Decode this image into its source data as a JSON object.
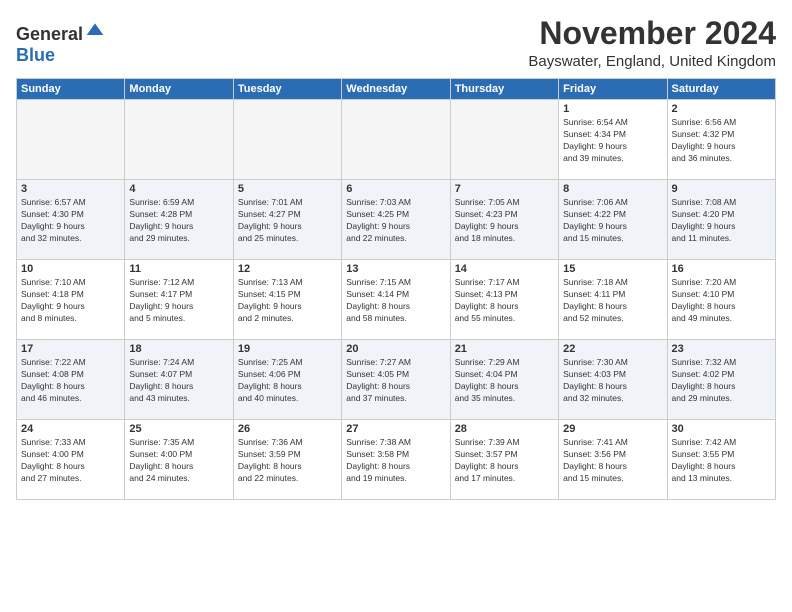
{
  "logo": {
    "general": "General",
    "blue": "Blue"
  },
  "header": {
    "month": "November 2024",
    "location": "Bayswater, England, United Kingdom"
  },
  "weekdays": [
    "Sunday",
    "Monday",
    "Tuesday",
    "Wednesday",
    "Thursday",
    "Friday",
    "Saturday"
  ],
  "weeks": [
    [
      {
        "day": "",
        "info": ""
      },
      {
        "day": "",
        "info": ""
      },
      {
        "day": "",
        "info": ""
      },
      {
        "day": "",
        "info": ""
      },
      {
        "day": "",
        "info": ""
      },
      {
        "day": "1",
        "info": "Sunrise: 6:54 AM\nSunset: 4:34 PM\nDaylight: 9 hours\nand 39 minutes."
      },
      {
        "day": "2",
        "info": "Sunrise: 6:56 AM\nSunset: 4:32 PM\nDaylight: 9 hours\nand 36 minutes."
      }
    ],
    [
      {
        "day": "3",
        "info": "Sunrise: 6:57 AM\nSunset: 4:30 PM\nDaylight: 9 hours\nand 32 minutes."
      },
      {
        "day": "4",
        "info": "Sunrise: 6:59 AM\nSunset: 4:28 PM\nDaylight: 9 hours\nand 29 minutes."
      },
      {
        "day": "5",
        "info": "Sunrise: 7:01 AM\nSunset: 4:27 PM\nDaylight: 9 hours\nand 25 minutes."
      },
      {
        "day": "6",
        "info": "Sunrise: 7:03 AM\nSunset: 4:25 PM\nDaylight: 9 hours\nand 22 minutes."
      },
      {
        "day": "7",
        "info": "Sunrise: 7:05 AM\nSunset: 4:23 PM\nDaylight: 9 hours\nand 18 minutes."
      },
      {
        "day": "8",
        "info": "Sunrise: 7:06 AM\nSunset: 4:22 PM\nDaylight: 9 hours\nand 15 minutes."
      },
      {
        "day": "9",
        "info": "Sunrise: 7:08 AM\nSunset: 4:20 PM\nDaylight: 9 hours\nand 11 minutes."
      }
    ],
    [
      {
        "day": "10",
        "info": "Sunrise: 7:10 AM\nSunset: 4:18 PM\nDaylight: 9 hours\nand 8 minutes."
      },
      {
        "day": "11",
        "info": "Sunrise: 7:12 AM\nSunset: 4:17 PM\nDaylight: 9 hours\nand 5 minutes."
      },
      {
        "day": "12",
        "info": "Sunrise: 7:13 AM\nSunset: 4:15 PM\nDaylight: 9 hours\nand 2 minutes."
      },
      {
        "day": "13",
        "info": "Sunrise: 7:15 AM\nSunset: 4:14 PM\nDaylight: 8 hours\nand 58 minutes."
      },
      {
        "day": "14",
        "info": "Sunrise: 7:17 AM\nSunset: 4:13 PM\nDaylight: 8 hours\nand 55 minutes."
      },
      {
        "day": "15",
        "info": "Sunrise: 7:18 AM\nSunset: 4:11 PM\nDaylight: 8 hours\nand 52 minutes."
      },
      {
        "day": "16",
        "info": "Sunrise: 7:20 AM\nSunset: 4:10 PM\nDaylight: 8 hours\nand 49 minutes."
      }
    ],
    [
      {
        "day": "17",
        "info": "Sunrise: 7:22 AM\nSunset: 4:08 PM\nDaylight: 8 hours\nand 46 minutes."
      },
      {
        "day": "18",
        "info": "Sunrise: 7:24 AM\nSunset: 4:07 PM\nDaylight: 8 hours\nand 43 minutes."
      },
      {
        "day": "19",
        "info": "Sunrise: 7:25 AM\nSunset: 4:06 PM\nDaylight: 8 hours\nand 40 minutes."
      },
      {
        "day": "20",
        "info": "Sunrise: 7:27 AM\nSunset: 4:05 PM\nDaylight: 8 hours\nand 37 minutes."
      },
      {
        "day": "21",
        "info": "Sunrise: 7:29 AM\nSunset: 4:04 PM\nDaylight: 8 hours\nand 35 minutes."
      },
      {
        "day": "22",
        "info": "Sunrise: 7:30 AM\nSunset: 4:03 PM\nDaylight: 8 hours\nand 32 minutes."
      },
      {
        "day": "23",
        "info": "Sunrise: 7:32 AM\nSunset: 4:02 PM\nDaylight: 8 hours\nand 29 minutes."
      }
    ],
    [
      {
        "day": "24",
        "info": "Sunrise: 7:33 AM\nSunset: 4:00 PM\nDaylight: 8 hours\nand 27 minutes."
      },
      {
        "day": "25",
        "info": "Sunrise: 7:35 AM\nSunset: 4:00 PM\nDaylight: 8 hours\nand 24 minutes."
      },
      {
        "day": "26",
        "info": "Sunrise: 7:36 AM\nSunset: 3:59 PM\nDaylight: 8 hours\nand 22 minutes."
      },
      {
        "day": "27",
        "info": "Sunrise: 7:38 AM\nSunset: 3:58 PM\nDaylight: 8 hours\nand 19 minutes."
      },
      {
        "day": "28",
        "info": "Sunrise: 7:39 AM\nSunset: 3:57 PM\nDaylight: 8 hours\nand 17 minutes."
      },
      {
        "day": "29",
        "info": "Sunrise: 7:41 AM\nSunset: 3:56 PM\nDaylight: 8 hours\nand 15 minutes."
      },
      {
        "day": "30",
        "info": "Sunrise: 7:42 AM\nSunset: 3:55 PM\nDaylight: 8 hours\nand 13 minutes."
      }
    ]
  ]
}
